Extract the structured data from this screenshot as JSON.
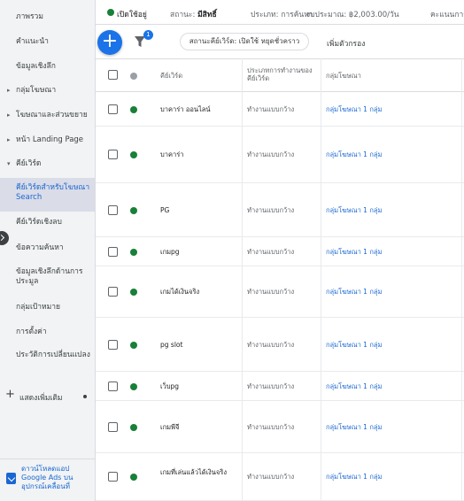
{
  "sidebar": {
    "items": [
      {
        "label": "ภาพรวม"
      },
      {
        "label": "คำแนะนำ"
      },
      {
        "label": "ข้อมูลเชิงลึก"
      },
      {
        "label": "กลุ่มโฆษณา"
      },
      {
        "label": "โฆษณาและส่วนขยาย"
      },
      {
        "label": "หน้า Landing Page"
      },
      {
        "label": "คีย์เวิร์ด"
      },
      {
        "label": "คีย์เวิร์ดสำหรับโฆษณา Search"
      },
      {
        "label": "คีย์เวิร์ดเชิงลบ"
      },
      {
        "label": "ข้อความค้นหา"
      },
      {
        "label": "ข้อมูลเชิงลึกด้านการประมูล"
      },
      {
        "label": "กลุ่มเป้าหมาย"
      },
      {
        "label": "การตั้งค่า"
      },
      {
        "label": "ประวัติการเปลี่ยนแปลง"
      }
    ],
    "show_more": "แสดงเพิ่มเติม",
    "download_app": "ดาวน์โหลดแอป Google Ads บนอุปกรณ์เคลื่อนที่"
  },
  "statusbar": {
    "status": "เปิดใช้อยู่",
    "status_label": "สถานะ:",
    "status_value": "มีสิทธิ์",
    "type_label": "ประเภท:",
    "type_value": "การค้นหา",
    "budget_label": "งบประมาณ:",
    "budget_value": "฿2,003.00/วัน",
    "score_label": "คะแนนการ"
  },
  "toolbar": {
    "add_label": "+",
    "filter_count": "1",
    "filter_chip": "สถานะคีย์เวิร์ด: เปิดใช้ หยุดชั่วคราว",
    "add_filter": "เพิ่มตัวกรอง"
  },
  "table": {
    "headers": {
      "keyword": "คีย์เวิร์ด",
      "status": "ประเภทการทำงานของคีย์เวิร์ด",
      "ad_group": "กลุ่มโฆษณา"
    },
    "rows": [
      {
        "keyword": "บาคาร่า ออนไลน์",
        "status": "ทำงานแบบกว้าง",
        "ad_group": "กลุ่มโฆษณา 1 กลุ่ม"
      },
      {
        "keyword": "บาคาร่า",
        "status": "ทำงานแบบกว้าง",
        "ad_group": "กลุ่มโฆษณา 1 กลุ่ม"
      },
      {
        "keyword": "PG",
        "status": "ทำงานแบบกว้าง",
        "ad_group": "กลุ่มโฆษณา 1 กลุ่ม"
      },
      {
        "keyword": "เกมpg",
        "status": "ทำงานแบบกว้าง",
        "ad_group": "กลุ่มโฆษณา 1 กลุ่ม"
      },
      {
        "keyword": "เกมได้เงินจริง",
        "status": "ทำงานแบบกว้าง",
        "ad_group": "กลุ่มโฆษณา 1 กลุ่ม"
      },
      {
        "keyword": "pg slot",
        "status": "ทำงานแบบกว้าง",
        "ad_group": "กลุ่มโฆษณา 1 กลุ่ม"
      },
      {
        "keyword": "เว็บpg",
        "status": "ทำงานแบบกว้าง",
        "ad_group": "กลุ่มโฆษณา 1 กลุ่ม"
      },
      {
        "keyword": "เกมพีจี",
        "status": "ทำงานแบบกว้าง",
        "ad_group": "กลุ่มโฆษณา 1 กลุ่ม"
      },
      {
        "keyword": "เกมที่เล่นแล้วได้เงินจริง",
        "status": "ทำงานแบบกว้าง",
        "ad_group": "กลุ่มโฆษณา 1 กลุ่ม"
      }
    ]
  },
  "colors": {
    "accent": "#1a73e8",
    "enabled_green": "#188038",
    "link_blue": "#1967d2"
  }
}
